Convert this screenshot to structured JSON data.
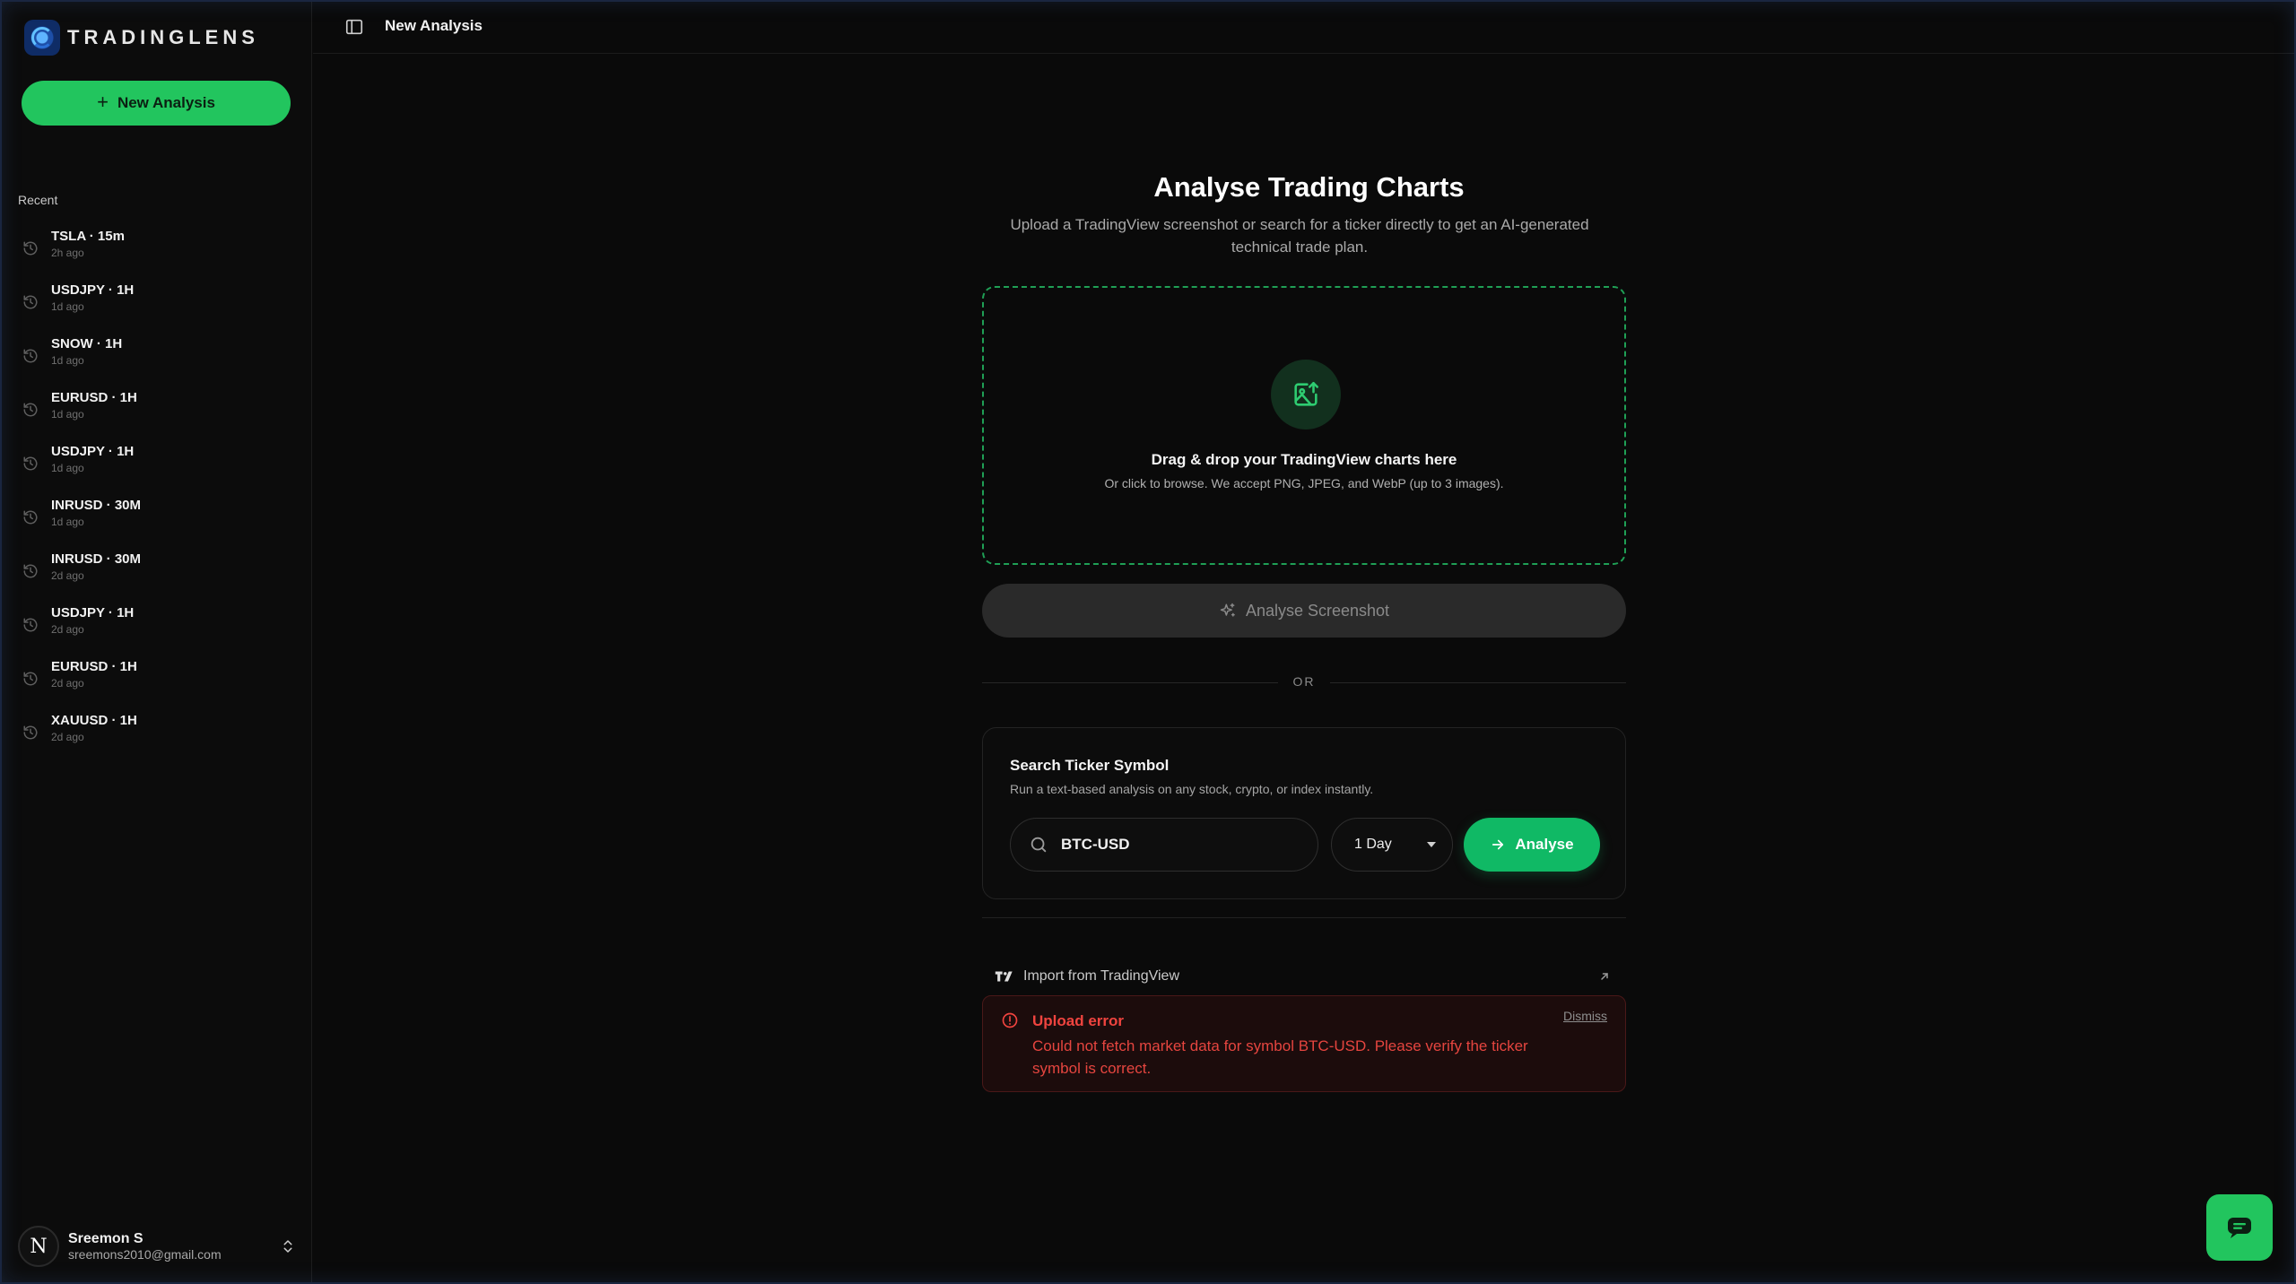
{
  "brand": {
    "name": "TRADINGLENS"
  },
  "sidebar": {
    "new_analysis_label": "New Analysis",
    "recent_label": "Recent",
    "items": [
      {
        "title": "TSLA · 15m",
        "time": "2h ago"
      },
      {
        "title": "USDJPY · 1H",
        "time": "1d ago"
      },
      {
        "title": "SNOW · 1H",
        "time": "1d ago"
      },
      {
        "title": "EURUSD · 1H",
        "time": "1d ago"
      },
      {
        "title": "USDJPY · 1H",
        "time": "1d ago"
      },
      {
        "title": "INRUSD · 30M",
        "time": "1d ago"
      },
      {
        "title": "INRUSD · 30M",
        "time": "2d ago"
      },
      {
        "title": "USDJPY · 1H",
        "time": "2d ago"
      },
      {
        "title": "EURUSD · 1H",
        "time": "2d ago"
      },
      {
        "title": "XAUUSD · 1H",
        "time": "2d ago"
      }
    ],
    "user": {
      "initial": "N",
      "name": "Sreemon S",
      "email": "sreemons2010@gmail.com"
    }
  },
  "topbar": {
    "title": "New Analysis"
  },
  "main": {
    "title": "Analyse Trading Charts",
    "subtitle": "Upload a TradingView screenshot or search for a ticker directly to get an AI-generated technical trade plan.",
    "dropzone": {
      "title": "Drag & drop your TradingView charts here",
      "subtitle": "Or click to browse. We accept PNG, JPEG, and WebP (up to 3 images)."
    },
    "analyse_screenshot_label": "Analyse Screenshot",
    "or_label": "OR",
    "search": {
      "title": "Search Ticker Symbol",
      "subtitle": "Run a text-based analysis on any stock, crypto, or index instantly.",
      "value": "BTC-USD",
      "timeframe": "1 Day",
      "button_label": "Analyse"
    },
    "import_label": "Import from TradingView",
    "error": {
      "title": "Upload error",
      "message": "Could not fetch market data for symbol BTC-USD. Please verify the ticker symbol is correct.",
      "dismiss_label": "Dismiss"
    }
  },
  "colors": {
    "accent_green": "#22c55e",
    "analyse_green": "#10b965",
    "error_red": "#f0443f",
    "background": "#0a0a0a"
  },
  "icons": [
    "logo-icon",
    "plus-icon",
    "history-icon",
    "panel-toggle-icon",
    "image-upload-icon",
    "sparkle-icon",
    "search-icon",
    "chevron-down-icon",
    "arrow-right-icon",
    "tradingview-icon",
    "external-link-icon",
    "alert-circle-icon",
    "chat-icon",
    "chevron-updown-icon"
  ]
}
